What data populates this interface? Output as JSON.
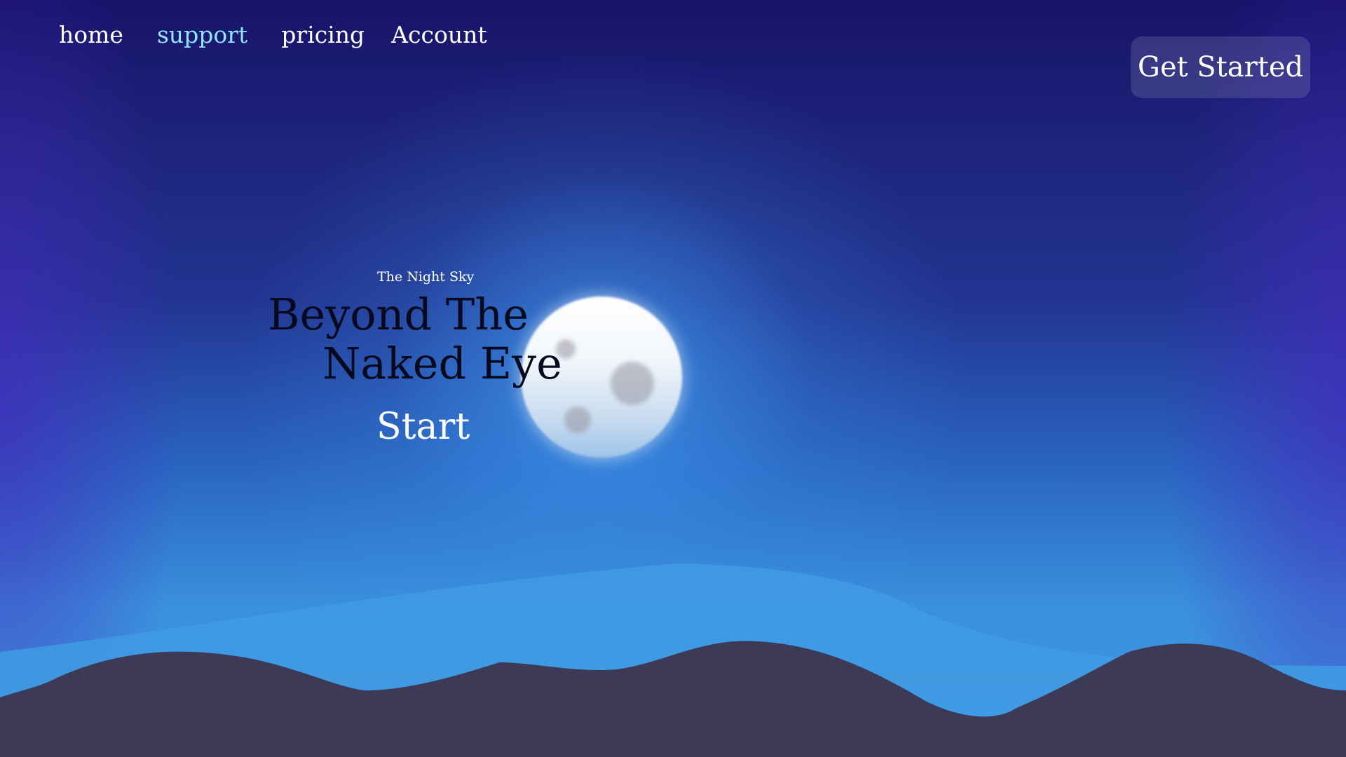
{
  "nav": {
    "items": [
      {
        "label": "home"
      },
      {
        "label": "support",
        "active": true
      },
      {
        "label": "pricing"
      },
      {
        "label": "Account"
      }
    ]
  },
  "header": {
    "cta_label": "Get Started"
  },
  "hero": {
    "eyebrow": "The Night Sky",
    "title_line1": "Beyond The",
    "title_line2": "Naked Eye",
    "start_label": "Start"
  },
  "colors": {
    "sky_top": "#18136a",
    "sky_bottom": "#3e9ae2",
    "nav_active": "#8fe6ff",
    "hill_front": "#3c3a57",
    "hill_back": "#3f9be3",
    "heading_text": "#070a1e"
  }
}
